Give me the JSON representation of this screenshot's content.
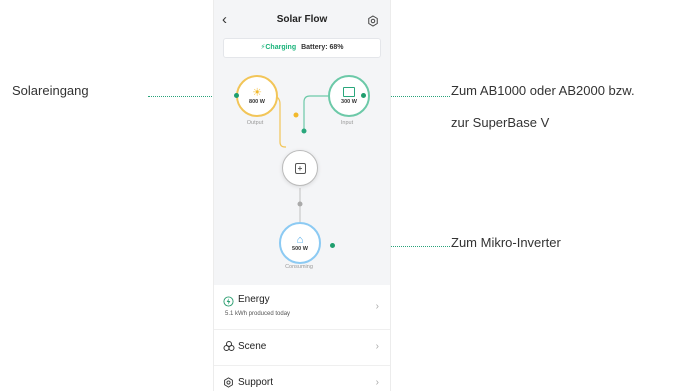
{
  "header": {
    "title": "Solar Flow",
    "back_icon": "chevron-left-icon",
    "settings_icon": "gear-icon"
  },
  "status": {
    "charging_label": "Charging",
    "battery_text": "Battery: 68%",
    "charging_color": "#19b37a"
  },
  "flow": {
    "output": {
      "value": "800 W",
      "label": "Output",
      "icon": "solar-panel-icon",
      "color": "#f2b92c"
    },
    "input": {
      "value": "300 W",
      "label": "Input",
      "icon": "battery-icon",
      "color": "#29a77c"
    },
    "hub": {
      "icon": "hub-device-icon"
    },
    "consuming": {
      "value": "500 W",
      "label": "Consuming",
      "icon": "home-icon",
      "color": "#4aa8e8"
    }
  },
  "menu": [
    {
      "label": "Energy",
      "subtext": "5.1 kWh produced today",
      "icon": "energy-icon"
    },
    {
      "label": "Scene",
      "icon": "scene-icon"
    },
    {
      "label": "Support",
      "icon": "support-icon"
    }
  ],
  "annotations": {
    "left": "Solareingang",
    "right_top_line1": "Zum AB1000 oder AB2000 bzw.",
    "right_top_line2": "zur SuperBase V",
    "right_bottom": "Zum Mikro-Inverter",
    "line_color": "#1f9e6e"
  }
}
